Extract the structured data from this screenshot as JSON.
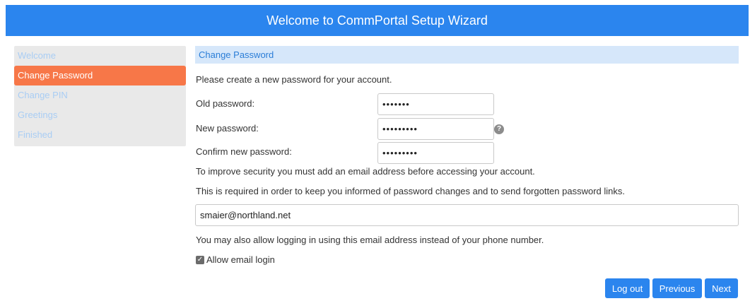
{
  "header": {
    "title": "Welcome to CommPortal Setup Wizard"
  },
  "sidebar": {
    "items": [
      {
        "label": "Welcome"
      },
      {
        "label": "Change Password"
      },
      {
        "label": "Change PIN"
      },
      {
        "label": "Greetings"
      },
      {
        "label": "Finished"
      }
    ],
    "active_index": 1
  },
  "main": {
    "section_title": "Change Password",
    "intro": "Please create a new password for your account.",
    "old_password": {
      "label": "Old password:",
      "value": "•••••••"
    },
    "new_password": {
      "label": "New password:",
      "value": "•••••••••",
      "help_icon": "?"
    },
    "confirm_password": {
      "label": "Confirm new password:",
      "value": "•••••••••"
    },
    "security_note": "To improve security you must add an email address before accessing your account.",
    "required_note": "This is required in order to keep you informed of password changes and to send forgotten password links.",
    "email": {
      "value": "smaier@northland.net"
    },
    "email_login_note": "You may also allow logging in using this email address instead of your phone number.",
    "allow_email_login": {
      "label": "Allow email login",
      "checked": true
    }
  },
  "buttons": {
    "logout": "Log out",
    "previous": "Previous",
    "next": "Next"
  },
  "colors": {
    "header": "#2b85ee",
    "active_nav": "#f77748",
    "section_bg": "#d6e7fa",
    "button": "#2b85ee"
  }
}
